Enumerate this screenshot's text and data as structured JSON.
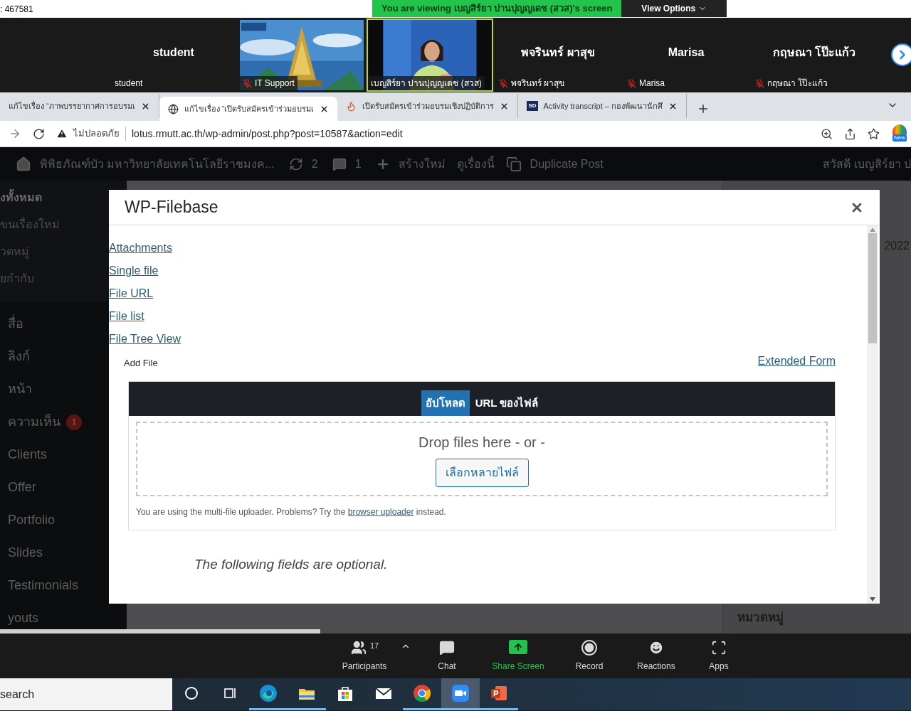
{
  "meeting_id": ": 467581",
  "share_banner": {
    "text": "You are viewing เบญสิร์ยา ปานปุญญเดช (สวส)'s screen",
    "view_options": "View Options"
  },
  "gallery": [
    {
      "kind": "name",
      "title": "student",
      "label": "student",
      "muted": false,
      "speaking": false
    },
    {
      "kind": "picture",
      "label": "IT Support",
      "muted": true,
      "speaking": false
    },
    {
      "kind": "video",
      "label": "เบญสิร์ยา ปานปุญญเดช (สวส)",
      "muted": false,
      "speaking": true
    },
    {
      "kind": "name",
      "title": "พจรินทร์ ผาสุข",
      "label": "พจรินทร์ ผาสุข",
      "muted": true,
      "speaking": false
    },
    {
      "kind": "name",
      "title": "Marisa",
      "label": "Marisa",
      "muted": true,
      "speaking": false
    },
    {
      "kind": "name",
      "title": "กฤษณา โป๊ะแก้ว",
      "label": "กฤษณา โป๊ะแก้ว",
      "muted": true,
      "speaking": false
    }
  ],
  "browser": {
    "tabs": [
      {
        "title": "แก้ไขเรื่อง “ภาพบรรยากาศการอบรมเ",
        "kind": "plain",
        "selected": false
      },
      {
        "title": "แก้ไขเรื่อง “เปิดรับสมัครเข้าร่วมอบรมเ",
        "kind": "globe",
        "selected": true
      },
      {
        "title": "เปิดรับสมัครเข้าร่วมอบรมเชิงปฏิบัติการ",
        "kind": "flame",
        "selected": false
      },
      {
        "title": "Activity transcript – กองพัฒนานักศึ",
        "kind": "badge",
        "badge": "SD",
        "selected": false
      }
    ],
    "security": "ไม่ปลอดภัย",
    "url": "lotus.rmutt.ac.th/wp-admin/post.php?post=10587&action=edit",
    "profile_badge": "New"
  },
  "admin_bar": {
    "site": "พิพิธภัณฑ์บัว มหาวิทยาลัยเทคโนโลยีราชมงค...",
    "updates": "2",
    "comments": "1",
    "new": "สร้างใหม่",
    "view": "ดูเรื่องนี้",
    "duplicate": "Duplicate Post",
    "greeting": "สวัสดี เบญสิร์ยา ป"
  },
  "sidebar": [
    {
      "kind": "sub",
      "label": "งทั้งหมด",
      "current": true
    },
    {
      "kind": "sub",
      "label": "ขนเรื่องใหม่",
      "current": false
    },
    {
      "kind": "sub",
      "label": "วดหมู่",
      "current": false
    },
    {
      "kind": "sub",
      "label": "ยกำกับ",
      "current": false
    },
    {
      "kind": "menu",
      "label": "สื่อ"
    },
    {
      "kind": "menu",
      "label": "ลิงก์"
    },
    {
      "kind": "menu",
      "label": "หน้า"
    },
    {
      "kind": "menu",
      "label": "ความเห็น",
      "badge": "1"
    },
    {
      "kind": "menu",
      "label": "Clients"
    },
    {
      "kind": "menu",
      "label": "Offer"
    },
    {
      "kind": "menu",
      "label": "Portfolio"
    },
    {
      "kind": "menu",
      "label": "Slides"
    },
    {
      "kind": "menu",
      "label": "Testimonials"
    },
    {
      "kind": "menu",
      "label": "youts"
    }
  ],
  "background": {
    "year": "2022",
    "category_heading": "หมวดหมู่"
  },
  "modal": {
    "title": "WP-Filebase",
    "links": [
      "Attachments",
      "Single file",
      "File URL",
      "File list",
      "File Tree View"
    ],
    "add_file": "Add File",
    "extended_form": "Extended Form",
    "upload_tabs": [
      {
        "label": "อัปโหลด",
        "selected": true
      },
      {
        "label": "URL ของไฟล์",
        "selected": false
      }
    ],
    "drop_text": "Drop files here - or -",
    "select_button": "เลือกหลายไฟล์",
    "note_before": "You are using the multi-file uploader. Problems? Try the",
    "note_link": "browser uploader",
    "note_after": "instead.",
    "optional_note": "The following fields are optional."
  },
  "zoom_toolbar": [
    {
      "kind": "participants",
      "label": "Participants",
      "count": "17"
    },
    {
      "kind": "chat",
      "label": "Chat"
    },
    {
      "kind": "share",
      "label": "Share Screen"
    },
    {
      "kind": "record",
      "label": "Record"
    },
    {
      "kind": "reactions",
      "label": "Reactions"
    },
    {
      "kind": "apps",
      "label": "Apps"
    }
  ],
  "taskbar": {
    "search": "search",
    "apps": [
      {
        "kind": "cortana",
        "running": false,
        "selected": false
      },
      {
        "kind": "taskview",
        "running": false,
        "selected": false
      },
      {
        "kind": "edge",
        "running": true,
        "selected": false
      },
      {
        "kind": "explorer",
        "running": true,
        "selected": false
      },
      {
        "kind": "store",
        "running": false,
        "selected": false
      },
      {
        "kind": "mail",
        "running": false,
        "selected": false
      },
      {
        "kind": "chrome",
        "running": true,
        "selected": false
      },
      {
        "kind": "zoom",
        "running": true,
        "selected": true
      },
      {
        "kind": "powerpoint",
        "running": true,
        "selected": false
      }
    ]
  }
}
